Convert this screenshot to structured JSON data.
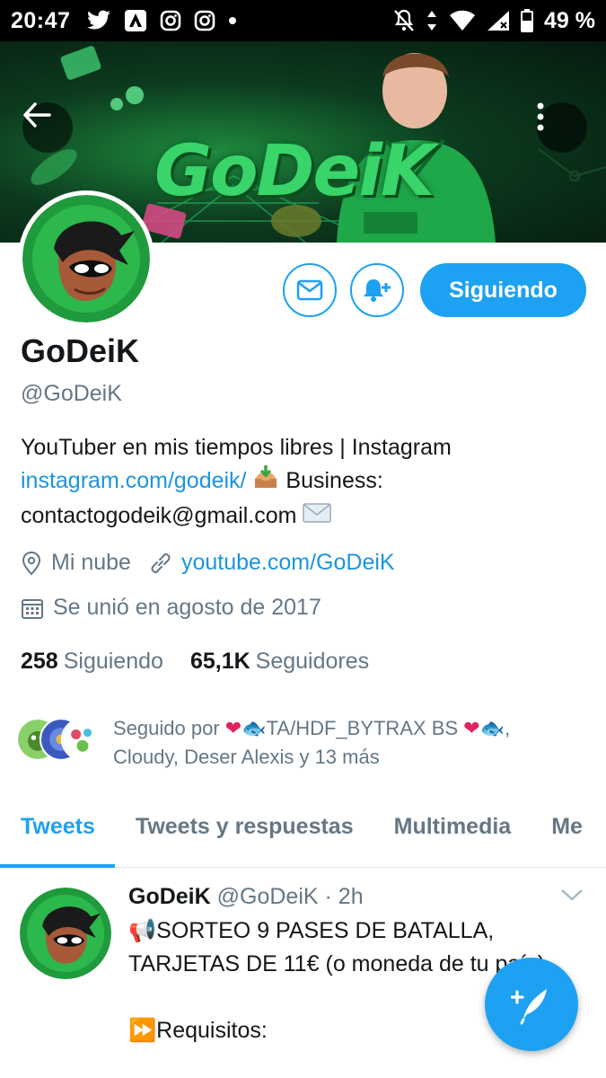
{
  "status_bar": {
    "time": "20:47",
    "battery": "49 %"
  },
  "profile": {
    "name": "GoDeiK",
    "handle": "@GoDeiK",
    "banner_logo_text": "GoDeiK",
    "bio_line1": "YouTuber en mis tiempos libres | Instagram",
    "bio_link": "instagram.com/godeik/",
    "bio_after_link": " Business:",
    "bio_line3": "contactogodeik@gmail.com ",
    "location": "Mi nube",
    "website": "youtube.com/GoDeiK",
    "joined": "Se unió en agosto de 2017",
    "following_count": "258",
    "following_label": "Siguiendo",
    "followers_count": "65,1K",
    "followers_label": "Seguidores",
    "follow_button_label": "Siguiendo",
    "followed_by_prefix": "Seguido por ",
    "followed_by_name": "TA/HDF_BYTRAX BS ",
    "followed_by_rest": "Cloudy, Deser Alexis y 13 más"
  },
  "tabs": [
    {
      "label": "Tweets",
      "active": true
    },
    {
      "label": "Tweets y respuestas",
      "active": false
    },
    {
      "label": "Multimedia",
      "active": false
    },
    {
      "label": "Me",
      "active": false
    }
  ],
  "tweet": {
    "author": "GoDeiK",
    "handle": "@GoDeiK",
    "time": "· 2h",
    "text": "SORTEO 9 PASES DE BATALLA,\nTARJETAS DE 11€ (o moneda de tu país)\n\n",
    "requisitos": "Requisitos:"
  },
  "colors": {
    "accent": "#1da1f2",
    "link": "#1b95e0",
    "secondary_text": "#657786",
    "heart": "#e0245e"
  }
}
